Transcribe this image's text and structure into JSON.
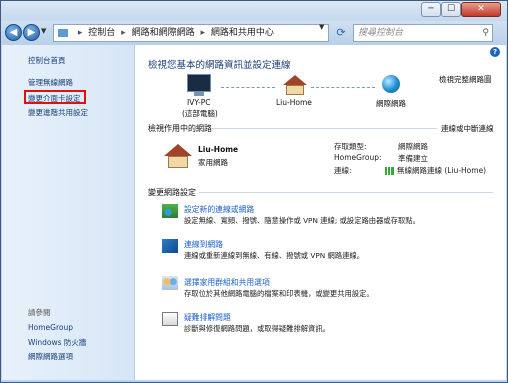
{
  "window": {
    "min": "─",
    "max": "☐",
    "close": "✕"
  },
  "nav": {
    "back": "◀",
    "forward": "▶",
    "breadcrumb": [
      "控制台",
      "網路和網際網路",
      "網路和共用中心"
    ],
    "search_placeholder": "搜尋控制台"
  },
  "sidebar": {
    "items": [
      "控制台首頁",
      "管理無線網路",
      "變更介面卡設定",
      "變更進階共用設定"
    ],
    "see_also_title": "請參閱",
    "see_also": [
      "HomeGroup",
      "Windows 防火牆",
      "網際網路選項"
    ]
  },
  "main": {
    "title": "檢視您基本的網路資訊並設定連線",
    "view_full_map": "檢視完整網路圖",
    "map": {
      "pc_name": "IVY-PC",
      "pc_sub": "(這部電腦)",
      "network": "Liu-Home",
      "internet": "網際網路"
    },
    "active_title": "檢視作用中的網路",
    "connect_disconnect": "連線或中斷連線",
    "active": {
      "name": "Liu-Home",
      "type": "家用網路",
      "access_type_label": "存取類型:",
      "access_type_value": "網際網路",
      "homegroup_label": "HomeGroup:",
      "homegroup_value": "準備建立",
      "connection_label": "連線:",
      "connection_value": "無線網路連線 (Liu-Home)"
    },
    "change_title": "變更網路設定",
    "tasks": [
      {
        "title": "設定新的連線或網路",
        "desc": "設定無線、寬頻、撥號、隨意操作或 VPN 連線; 或設定路由器或存取點。"
      },
      {
        "title": "連線到網路",
        "desc": "連線或重新連線到無線、有線、撥號或 VPN 網路連線。"
      },
      {
        "title": "選擇家用群組和共用選項",
        "desc": "存取位於其他網路電腦的檔案和印表機，或變更共用設定。"
      },
      {
        "title": "疑難排解問題",
        "desc": "診斷與修復網路問題，或取得疑難排解資訊。"
      }
    ],
    "help": "?"
  }
}
